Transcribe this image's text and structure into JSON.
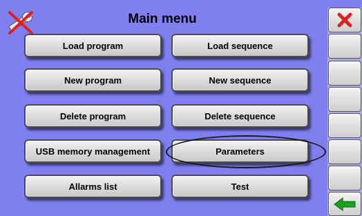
{
  "header": {
    "title": "Main menu",
    "logo_icon": "crossed-out-wrench-icon",
    "close_icon": "red-x-close-icon"
  },
  "menu": {
    "load_program": "Load program",
    "load_sequence": "Load sequence",
    "new_program": "New program",
    "new_sequence": "New sequence",
    "delete_program": "Delete program",
    "delete_sequence": "Delete sequence",
    "usb_memory_management": "USB memory management",
    "parameters": "Parameters",
    "allarms_list": "Allarms list",
    "test": "Test"
  },
  "sidebar": {
    "back_icon": "green-left-arrow-icon"
  },
  "colors": {
    "background": "#7f7ff0",
    "sidebar": "#a9a9ee",
    "close_red": "#e02020",
    "back_green": "#1ea01e"
  }
}
